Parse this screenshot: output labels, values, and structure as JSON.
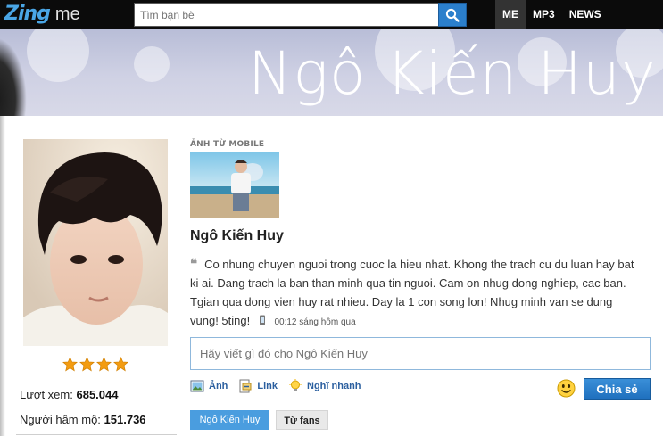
{
  "topbar": {
    "logo_zing": "Zing",
    "logo_me": "me",
    "search_placeholder": "Tìm bạn bè",
    "nav": [
      "ME",
      "MP3",
      "NEWS"
    ]
  },
  "banner": {
    "title": "Ngô Kiến Huy"
  },
  "profile": {
    "stars": 4,
    "views_label": "Lượt xem:",
    "views_value": "685.044",
    "fans_label": "Người hâm mộ:",
    "fans_value": "151.736"
  },
  "feed": {
    "section_label": "ẢNH TỪ MOBILE",
    "author_name": "Ngô Kiến Huy",
    "status_text": "Co nhung chuyen nguoi trong cuoc la hieu nhat. Khong the trach cu du luan hay bat ki ai. Dang trach la ban than minh qua tin nguoi. Cam on nhug dong nghiep, cac ban. Tgian qua dong vien huy rat nhieu. Day la 1 con song lon! Nhug minh van se dung vung! 5ting!",
    "status_time": "00:12 sáng hôm qua",
    "composer_placeholder": "Hãy viết gì đó cho Ngô Kiến Huy",
    "actions": {
      "photo": "Ảnh",
      "link": "Link",
      "idea": "Nghĩ nhanh"
    },
    "share_label": "Chia sẻ",
    "tabs": {
      "primary": "Ngô Kiến Huy",
      "secondary": "Từ fans"
    }
  },
  "colors": {
    "accent": "#2b7fcc",
    "link": "#2b5f9f",
    "star": "#f39c12"
  }
}
